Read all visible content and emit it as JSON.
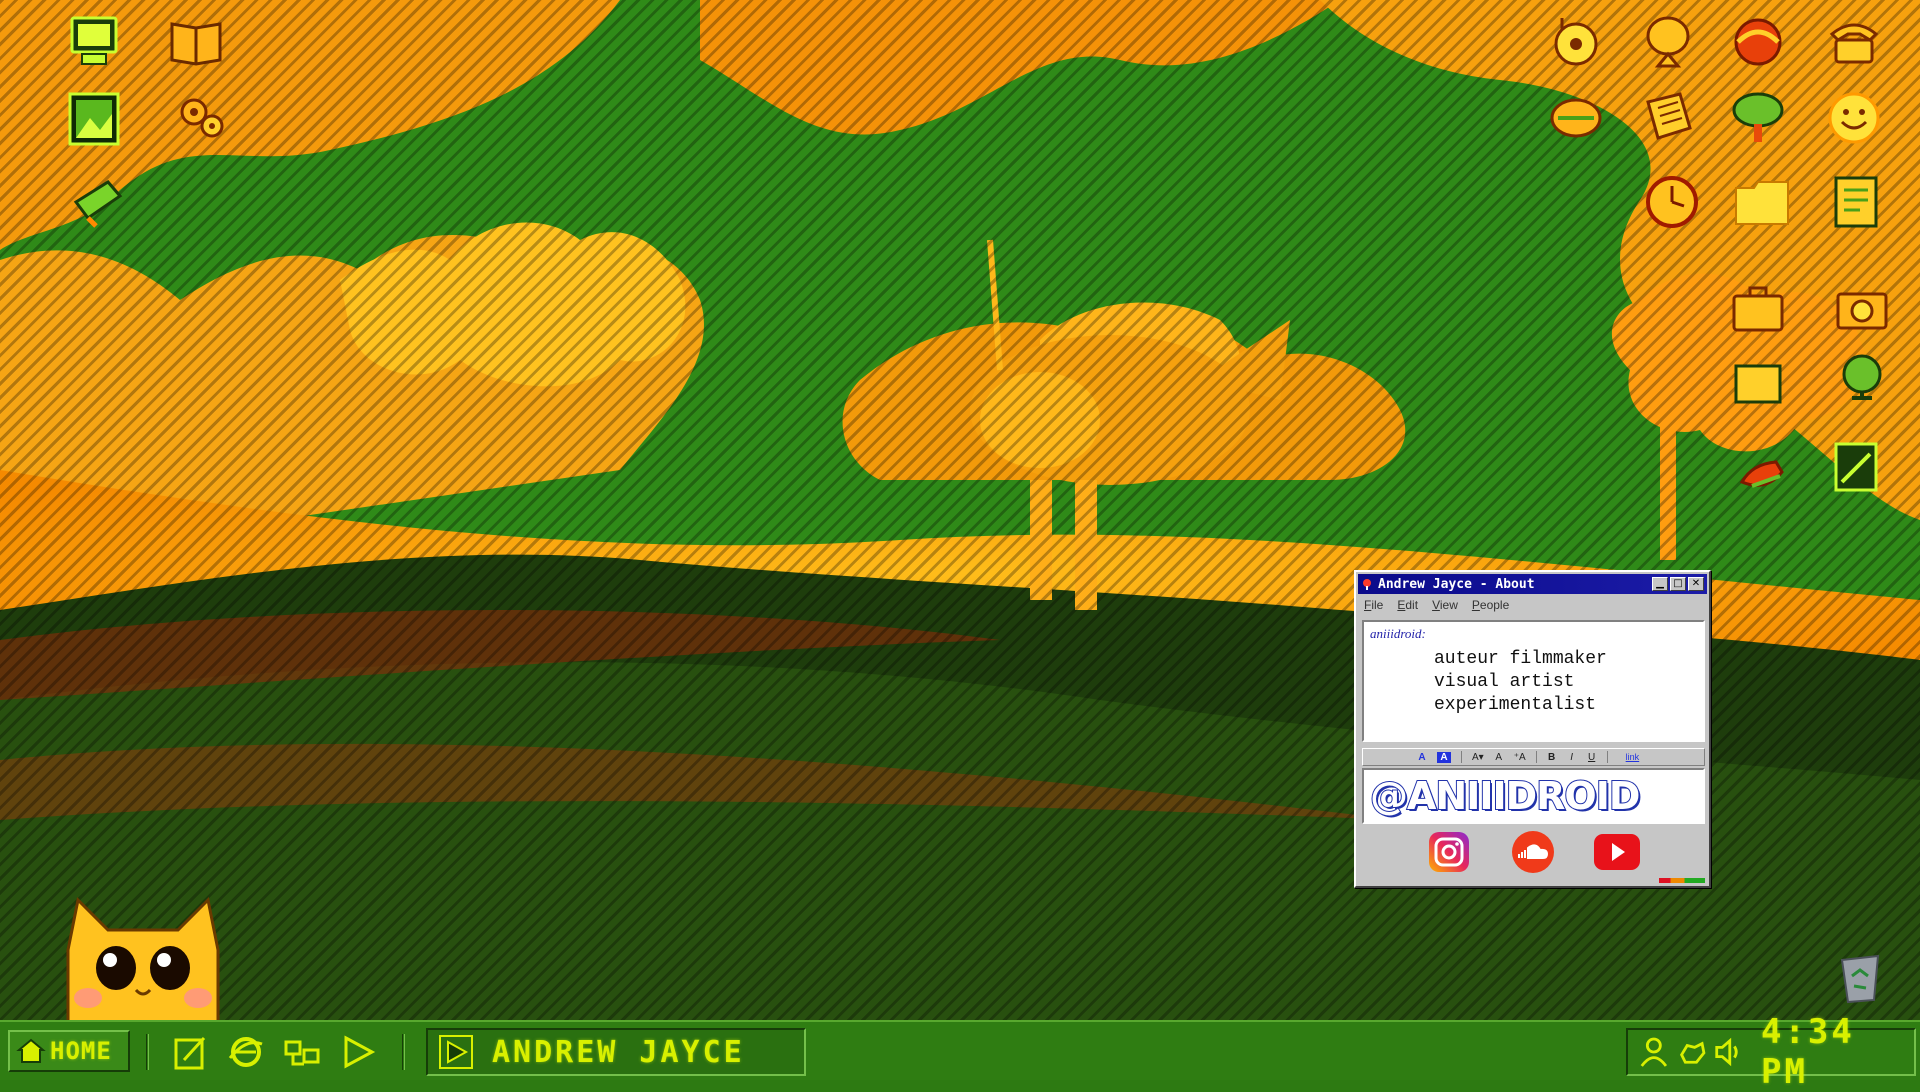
{
  "about_window": {
    "title": "Andrew Jayce - About",
    "menu": [
      "File",
      "Edit",
      "View",
      "People"
    ],
    "sender": "aniiidroid:",
    "lines": [
      "auteur filmmaker",
      "visual artist",
      "experimentalist"
    ],
    "format_bar": {
      "text_color": "A",
      "highlight": "A",
      "font_shrink": "A▾",
      "font_normal": "A",
      "font_grow": "⁺A",
      "bold": "B",
      "italic": "I",
      "underline": "U",
      "link": "link"
    },
    "handle": "@ANIIIDROID",
    "social": [
      "instagram",
      "soundcloud",
      "youtube"
    ]
  },
  "desktop_icons": {
    "left": [
      "computer",
      "book",
      "picture",
      "gears",
      "toolbox"
    ],
    "right": [
      "music-cd",
      "satellite-dish",
      "internet-globe",
      "telephone",
      "world-globe",
      "newspaper",
      "tree",
      "smiley",
      "clock",
      "folder",
      "notepad",
      "briefcase",
      "camera",
      "folder-small",
      "globe-stand",
      "apple",
      "pad"
    ]
  },
  "taskbar": {
    "home_label": "HOME",
    "task_label": "ANDREW JAYCE",
    "clock": "4:34 PM",
    "quick_launch": [
      "notepad",
      "internet-explorer",
      "network",
      "media-play"
    ],
    "tray": [
      "user",
      "network-hand",
      "volume"
    ]
  },
  "colors": {
    "taskbar": "#2f7d12",
    "lcd_text": "#d8f000",
    "title_bar": "#0a0a8a",
    "handle": "#2233aa"
  }
}
